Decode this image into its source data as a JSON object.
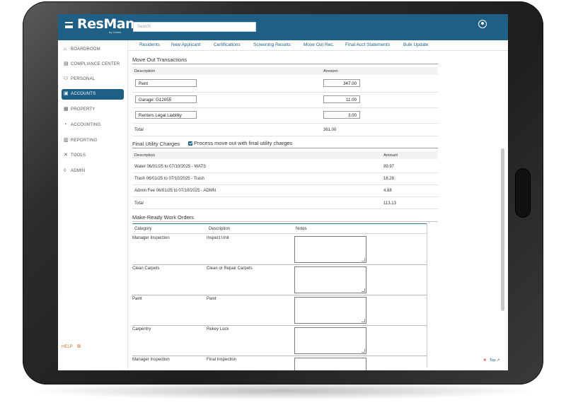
{
  "app": {
    "logo": "ResMan",
    "logo_sub": "by Inhabit"
  },
  "header": {
    "search_placeholder": "Search"
  },
  "sidebar": {
    "items": [
      {
        "label": "BOARDROOM",
        "icon": "home-icon",
        "glyph": "⌂"
      },
      {
        "label": "COMPLIANCE CENTER",
        "icon": "clipboard-icon",
        "glyph": "▤"
      },
      {
        "label": "PERSONAL",
        "icon": "person-icon",
        "glyph": "⚇"
      },
      {
        "label": "ACCOUNTS",
        "icon": "people-icon",
        "glyph": "▣",
        "active": true
      },
      {
        "label": "PROPERTY",
        "icon": "building-icon",
        "glyph": "▦"
      },
      {
        "label": "ACCOUNTING",
        "icon": "gauge-icon",
        "glyph": "◔"
      },
      {
        "label": "REPORTING",
        "icon": "chart-icon",
        "glyph": "▥"
      },
      {
        "label": "TOOLS",
        "icon": "tools-icon",
        "glyph": "✕"
      },
      {
        "label": "ADMIN",
        "icon": "shield-icon",
        "glyph": "◊"
      }
    ],
    "help": "HELP"
  },
  "tabs": [
    "Residents",
    "New Applicant",
    "Certifications",
    "Screening Results",
    "Move Out Rec.",
    "Final Acct Statements",
    "Bulk Update"
  ],
  "move_out": {
    "title": "Move Out Transactions",
    "col_description": "Description",
    "col_amount": "Amount",
    "rows": [
      {
        "description": "Rent",
        "amount": "347.00"
      },
      {
        "description": "Garage: G12055",
        "amount": "11.00"
      },
      {
        "description": "Renters Legal Liability",
        "amount": "3.00"
      }
    ],
    "total_label": "Total",
    "total_value": "361.00"
  },
  "utility": {
    "title": "Final Utility Charges",
    "checkbox_label": "Process move out with final utility charges",
    "checked": true,
    "col_description": "Description",
    "col_amount": "Amount",
    "rows": [
      {
        "description": "Water 06/01/25 to 07/10/2025 - WATS",
        "amount": "89.97"
      },
      {
        "description": "Trash 06/01/25 to 07/10/2025 - Trash",
        "amount": "18.28"
      },
      {
        "description": "Admin Fee 06/01/25 to 07/10/2025 - ADMN",
        "amount": "4.88"
      }
    ],
    "total_label": "Total",
    "total_value": "113.13"
  },
  "make_ready": {
    "title": "Make-Ready Work Orders",
    "col_category": "Category",
    "col_description": "Description",
    "col_notes": "Notes",
    "rows": [
      {
        "category": "Manager Inspection",
        "description": "Inspect Unit"
      },
      {
        "category": "Clean Carpets",
        "description": "Clean or Repair Carpets"
      },
      {
        "category": "Paint",
        "description": "Paint"
      },
      {
        "category": "Carpentry",
        "description": "Rekey Lock"
      },
      {
        "category": "Manager Inspection",
        "description": "Final Inspection"
      }
    ]
  },
  "footer": {
    "top_label": "Top"
  }
}
